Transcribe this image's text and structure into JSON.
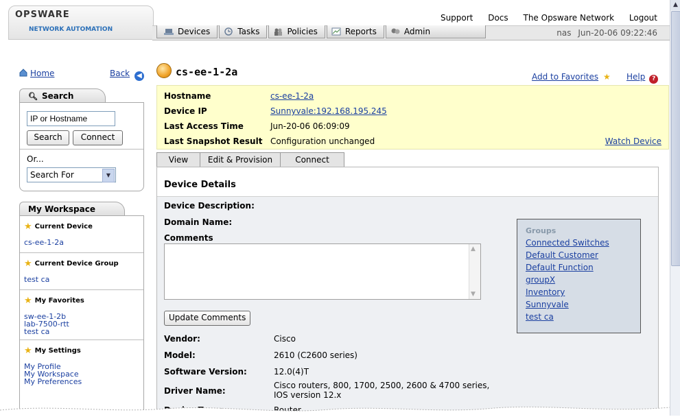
{
  "header": {
    "logo_text": "OPSWARE",
    "logo_subtitle": "NETWORK AUTOMATION",
    "top_links": [
      "Support",
      "Docs",
      "The Opsware Network",
      "Logout"
    ],
    "nav_tabs": [
      {
        "label": "Devices",
        "icon": "devices-icon"
      },
      {
        "label": "Tasks",
        "icon": "tasks-icon"
      },
      {
        "label": "Policies",
        "icon": "policies-icon"
      },
      {
        "label": "Reports",
        "icon": "reports-icon"
      },
      {
        "label": "Admin",
        "icon": "admin-icon"
      }
    ],
    "user": "nas",
    "timestamp": "Jun-20-06 09:22:46"
  },
  "sidebar": {
    "home_label": "Home",
    "back_label": "Back",
    "search": {
      "title": "Search",
      "input_value": "IP or Hostname",
      "search_button": "Search",
      "connect_button": "Connect",
      "or_label": "Or...",
      "select_value": "Search For"
    },
    "workspace": {
      "title": "My Workspace",
      "current_device_title": "Current Device",
      "current_device": "cs-ee-1-2a",
      "current_group_title": "Current Device Group",
      "current_group": "test ca",
      "favorites_title": "My Favorites",
      "favorites": [
        "sw-ee-1-2b",
        "lab-7500-rtt",
        "test ca"
      ],
      "settings_title": "My Settings",
      "settings": [
        "My Profile",
        "My Workspace",
        "My Preferences"
      ]
    }
  },
  "main": {
    "device_title": "cs-ee-1-2a",
    "add_favorites": "Add to Favorites",
    "help": "Help",
    "info": {
      "hostname_label": "Hostname",
      "hostname_value": "cs-ee-1-2a",
      "ip_label": "Device IP",
      "ip_value": "Sunnyvale:192.168.195.245",
      "access_label": "Last Access Time",
      "access_value": "Jun-20-06 06:09:09",
      "snapshot_label": "Last Snapshot Result",
      "snapshot_value": "Configuration unchanged",
      "watch_device": "Watch Device"
    },
    "tabs": [
      "View",
      "Edit & Provision",
      "Connect"
    ],
    "details": {
      "title": "Device Details",
      "description_label": "Device Description:",
      "domain_label": "Domain Name:",
      "comments_label": "Comments",
      "update_button": "Update Comments",
      "vendor_label": "Vendor:",
      "vendor_value": "Cisco",
      "model_label": "Model:",
      "model_value": "2610 (C2600 series)",
      "software_label": "Software Version:",
      "software_value": "12.0(4)T",
      "driver_label": "Driver Name:",
      "driver_value_1": "Cisco routers, 800, 1700, 2500, 2600 & 4700 series,",
      "driver_value_2": "IOS version 12.x",
      "type_label": "Device Type:",
      "type_value": "Router"
    },
    "groups": {
      "title": "Groups",
      "items": [
        "Connected Switches",
        "Default Customer",
        "Default Function",
        "groupX",
        "Inventory",
        "Sunnyvale",
        "test ca"
      ]
    }
  }
}
